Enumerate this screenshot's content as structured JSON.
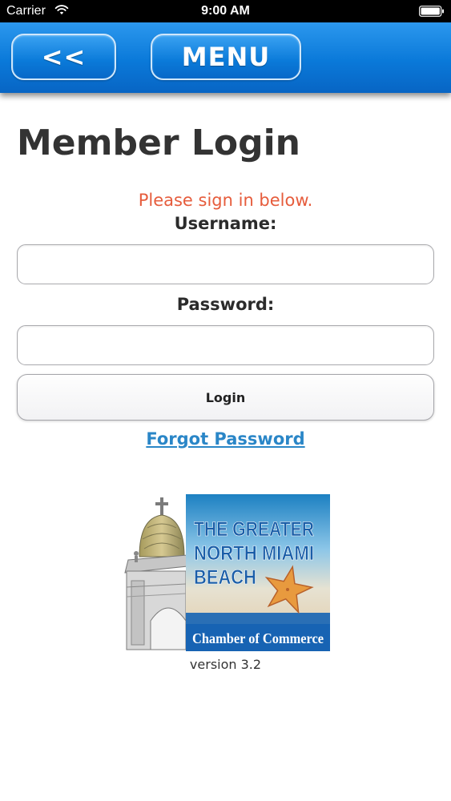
{
  "status_bar": {
    "carrier": "Carrier",
    "time": "9:00 AM",
    "wifi_icon": "wifi-icon",
    "battery_icon": "battery-icon"
  },
  "nav": {
    "back_label": "<<",
    "menu_label": "MENU",
    "bar_color": "#0a79d9"
  },
  "main": {
    "title": "Member Login",
    "signin_message": "Please sign in below.",
    "username_label": "Username:",
    "username_value": "",
    "password_label": "Password:",
    "password_value": "",
    "login_label": "Login",
    "forgot_password_label": "Forgot Password",
    "message_color": "#e65c3c",
    "link_color": "#2a86c7"
  },
  "logo": {
    "line1": "THE GREATER",
    "line2": "NORTH MIAMI",
    "line3": "BEACH",
    "footer": "Chamber of Commerce",
    "icons": [
      "building-dome-icon",
      "starfish-icon"
    ]
  },
  "version": "version 3.2"
}
